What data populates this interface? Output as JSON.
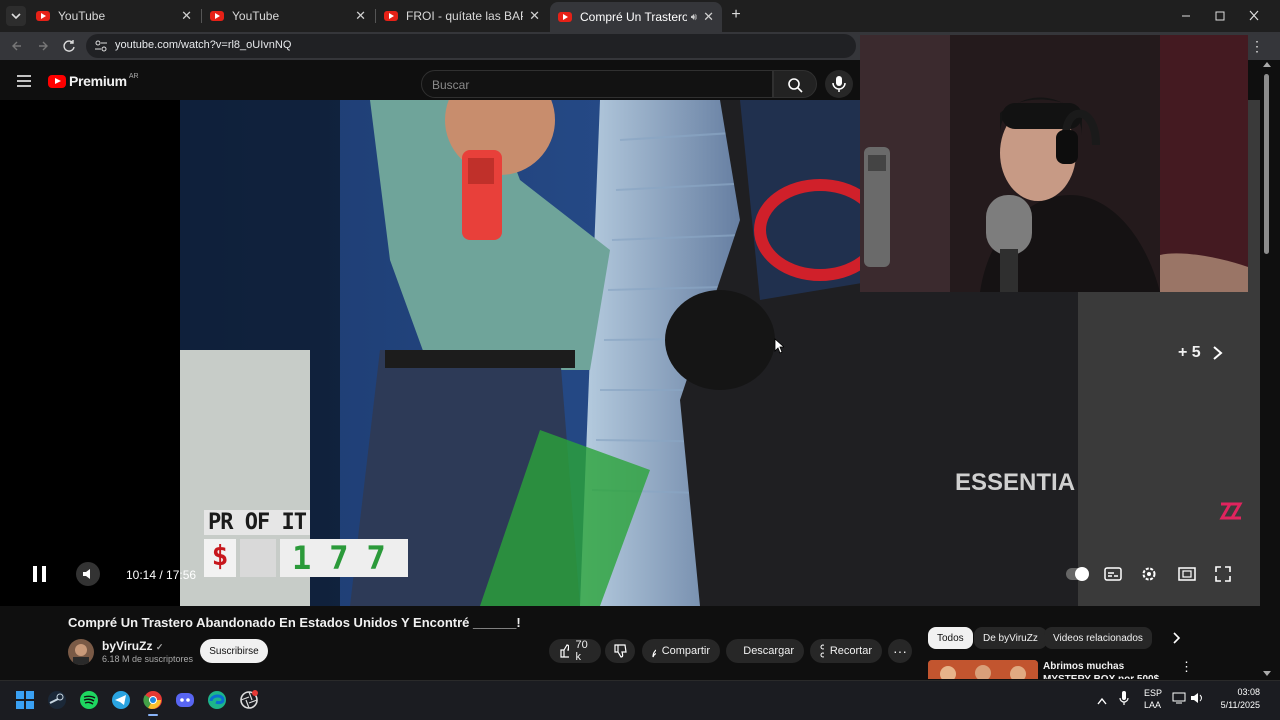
{
  "browser": {
    "tabs": [
      {
        "title": "YouTube",
        "active": false
      },
      {
        "title": "YouTube",
        "active": false
      },
      {
        "title": "FROI - quítate las BAPE (Visualiz",
        "active": false
      },
      {
        "title": "Compré Un Trastero Aband",
        "active": true
      }
    ],
    "url": "youtube.com/watch?v=rl8_oUIvnNQ"
  },
  "youtube": {
    "logo_text": "Premium",
    "region": "AR",
    "search_placeholder": "Buscar"
  },
  "player": {
    "time": "10:14 / 17:56",
    "progress_fraction": 0.57,
    "buffered_fraction": 0.59,
    "end_screen_more": "+ 5",
    "overlay_profit_label": "PR OF IT",
    "overlay_profit_value": "177",
    "overlay_currency": "$",
    "shirt_text": "ESSENTIA"
  },
  "video": {
    "title": "Compré Un Trastero Abandonado En Estados Unidos Y Encontré ______!",
    "channel": "byViruZz",
    "subscribers": "6.18 M de suscriptores",
    "subscribe_label": "Suscribirse",
    "likes": "70 k",
    "share_label": "Compartir",
    "download_label": "Descargar",
    "clip_label": "Recortar"
  },
  "recommendations": {
    "chips": [
      "Todos",
      "De byViruZz",
      "Videos relacionados"
    ],
    "first_title": "Abrimos muchas MYSTERY BOX por 500$"
  },
  "taskbar": {
    "lang_line1": "ESP",
    "lang_line2": "LAA",
    "time": "03:08",
    "date": "5/11/2025"
  },
  "colors": {
    "accent": "#ff0000",
    "background": "#0f0f0f"
  }
}
